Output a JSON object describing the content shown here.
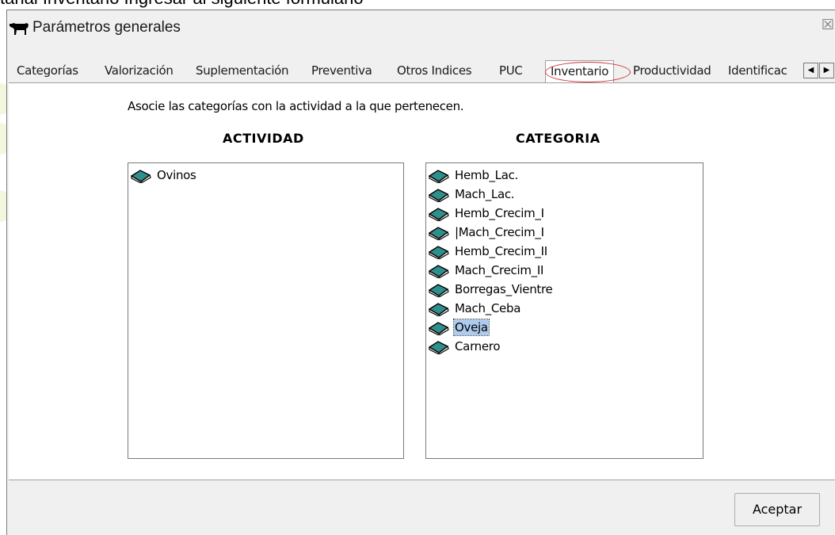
{
  "background_caption": "tanal Inventario Ingresar al siguiente formulario",
  "window": {
    "title": "Parámetros generales",
    "close_symbol": "☒"
  },
  "tabs": [
    {
      "label": "Categorías"
    },
    {
      "label": "Valorización"
    },
    {
      "label": "Suplementación"
    },
    {
      "label": "Preventiva"
    },
    {
      "label": "Otros Indices"
    },
    {
      "label": "PUC"
    },
    {
      "label": "Inventario",
      "active": true
    },
    {
      "label": "Productividad"
    },
    {
      "label": "Identificac"
    }
  ],
  "tab_scroll": {
    "left": "◀",
    "right": "▶"
  },
  "panel": {
    "instructions": "Asocie las categorías con la actividad a la que pertenecen.",
    "actividad_header": "ACTIVIDAD",
    "categoria_header": "CATEGORIA",
    "actividades": [
      "Ovinos"
    ],
    "categorias": [
      {
        "label": "Hemb_Lac."
      },
      {
        "label": "Mach_Lac."
      },
      {
        "label": "Hemb_Crecim_I"
      },
      {
        "label": "|Mach_Crecim_I"
      },
      {
        "label": "Hemb_Crecim_II"
      },
      {
        "label": "Mach_Crecim_II"
      },
      {
        "label": "Borregas_Vientre"
      },
      {
        "label": "Mach_Ceba"
      },
      {
        "label": "Oveja",
        "selected": true
      },
      {
        "label": "Carnero"
      }
    ]
  },
  "buttons": {
    "accept": "Aceptar"
  },
  "icons": {
    "window_icon": "cow-icon",
    "list_item_icon": "book-icon",
    "highlight_color": "#d23030",
    "selection_color": "#aecbef"
  }
}
